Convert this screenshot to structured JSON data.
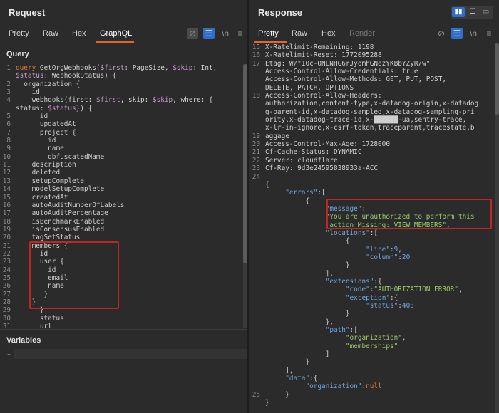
{
  "request": {
    "title": "Request",
    "tabs": [
      "Pretty",
      "Raw",
      "Hex",
      "GraphQL"
    ],
    "active_tab": "GraphQL",
    "query_label": "Query",
    "variables_label": "Variables",
    "variables_gutter": "1",
    "gutter": [
      "1",
      "2",
      "3",
      "4",
      "5",
      "6",
      "7",
      "8",
      "9",
      "10",
      "11",
      "12",
      "13",
      "14",
      "15",
      "16",
      "17",
      "18",
      "19",
      "20",
      "21",
      "22",
      "23",
      "24",
      "25",
      "26",
      "27",
      "28",
      "29",
      "30",
      "31"
    ],
    "lines": [
      [
        [
          "kw",
          "query "
        ],
        [
          "plain",
          "GetOrgWebhooks("
        ],
        [
          "var",
          "$first"
        ],
        [
          "plain",
          ": PageSize, "
        ],
        [
          "var",
          "$skip"
        ],
        [
          "plain",
          ": Int,"
        ]
      ],
      [
        [
          "var",
          "$status"
        ],
        [
          "plain",
          ": WebhookStatus) {"
        ]
      ],
      [
        [
          "plain",
          "  organization {"
        ]
      ],
      [
        [
          "plain",
          "    id"
        ]
      ],
      [
        [
          "plain",
          "    webhooks(first: "
        ],
        [
          "var",
          "$first"
        ],
        [
          "plain",
          ", skip: "
        ],
        [
          "var",
          "$skip"
        ],
        [
          "plain",
          ", where: {"
        ]
      ],
      [
        [
          "plain",
          "status: "
        ],
        [
          "var",
          "$status"
        ],
        [
          "plain",
          "}) {"
        ]
      ],
      [
        [
          "plain",
          "      id"
        ]
      ],
      [
        [
          "plain",
          "      updatedAt"
        ]
      ],
      [
        [
          "plain",
          "      project {"
        ]
      ],
      [
        [
          "plain",
          "        id"
        ]
      ],
      [
        [
          "plain",
          "        name"
        ]
      ],
      [
        [
          "plain",
          "        obfuscatedName"
        ]
      ],
      [
        [
          "plain",
          "    description"
        ]
      ],
      [
        [
          "plain",
          "    deleted"
        ]
      ],
      [
        [
          "plain",
          "    setupComplete"
        ]
      ],
      [
        [
          "plain",
          "    modelSetupComplete"
        ]
      ],
      [
        [
          "plain",
          "    createdAt"
        ]
      ],
      [
        [
          "plain",
          "    autoAuditNumberOfLabels"
        ]
      ],
      [
        [
          "plain",
          "    autoAuditPercentage"
        ]
      ],
      [
        [
          "plain",
          "    isBenchmarkEnabled"
        ]
      ],
      [
        [
          "plain",
          "    isConsensusEnabled"
        ]
      ],
      [
        [
          "plain",
          "    tagSetStatus"
        ]
      ],
      [
        [
          "plain",
          "    members {"
        ]
      ],
      [
        [
          "plain",
          "      id"
        ]
      ],
      [
        [
          "plain",
          "      user {"
        ]
      ],
      [
        [
          "plain",
          "        id"
        ]
      ],
      [
        [
          "plain",
          "        email"
        ]
      ],
      [
        [
          "plain",
          "        name"
        ]
      ],
      [
        [
          "plain",
          "       }"
        ]
      ],
      [
        [
          "plain",
          "    }"
        ]
      ],
      [
        [
          "plain",
          "      }"
        ]
      ],
      [
        [
          "plain",
          "      status"
        ]
      ],
      [
        [
          "plain",
          "      url"
        ]
      ]
    ]
  },
  "response": {
    "title": "Response",
    "tabs": [
      "Pretty",
      "Raw",
      "Hex",
      "Render"
    ],
    "active_tab": "Pretty",
    "gutter": [
      "15",
      "16",
      "17",
      "",
      "",
      "",
      "18",
      "",
      "",
      "",
      "",
      "19",
      "20",
      "21",
      "22",
      "23",
      "24",
      "",
      "",
      "",
      "",
      "",
      "",
      "",
      "",
      "",
      "",
      "",
      "",
      "",
      "",
      "",
      "",
      "",
      "",
      "",
      "",
      "",
      "",
      "",
      "",
      "",
      "",
      "",
      "25"
    ],
    "gutter_lines": [
      {
        "n": "15",
        "row": 0
      },
      {
        "n": "16",
        "row": 1
      },
      {
        "n": "17",
        "row": 2
      },
      {
        "n": "",
        "row": 3
      },
      {
        "n": "",
        "row": 4
      },
      {
        "n": "",
        "row": 5
      },
      {
        "n": "18",
        "row": 6
      },
      {
        "n": "19",
        "row": 11
      },
      {
        "n": "20",
        "row": 12
      },
      {
        "n": "21",
        "row": 13
      },
      {
        "n": "22",
        "row": 14
      },
      {
        "n": "23",
        "row": 15
      },
      {
        "n": "24",
        "row": 16
      },
      {
        "n": "25",
        "row": 43
      }
    ],
    "lines": [
      [
        [
          "plain",
          "X-Ratelimit-Remaining: 1198"
        ]
      ],
      [
        [
          "plain",
          "X-Ratelimit-Reset: 1772095288"
        ]
      ],
      [
        [
          "plain",
          "Etag: W/\"10c-ONLNHG6rJyomhGNezYKBbYZyR/w\""
        ]
      ],
      [
        [
          "plain",
          "Access-Control-Allow-Credentials: true"
        ]
      ],
      [
        [
          "plain",
          "Access-Control-Allow-Methods: GET, PUT, POST,"
        ]
      ],
      [
        [
          "plain",
          "DELETE, PATCH, OPTIONS"
        ]
      ],
      [
        [
          "plain",
          "Access-Control-Allow-Headers:"
        ]
      ],
      [
        [
          "plain",
          "authorization,content-type,x-datadog-origin,x-datadog"
        ]
      ],
      [
        [
          "plain",
          "g-parent-id,x-datadog-sampled,x-datadog-sampling-pri"
        ]
      ],
      [
        [
          "plain",
          "ority,x-datadog-trace-id,x-██████-ua,sentry-trace,"
        ]
      ],
      [
        [
          "plain",
          "x-lr-in-ignore,x-csrf-token,traceparent,tracestate,b"
        ]
      ],
      [
        [
          "plain",
          "aggage"
        ]
      ],
      [
        [
          "plain",
          "Access-Control-Max-Age: 1728000"
        ]
      ],
      [
        [
          "plain",
          "Cf-Cache-Status: DYNAMIC"
        ]
      ],
      [
        [
          "plain",
          "Server: cloudflare"
        ]
      ],
      [
        [
          "plain",
          "Cf-Ray: 9d3e24595838933a-ACC"
        ]
      ],
      [
        [
          "plain",
          ""
        ]
      ],
      [
        [
          "plain",
          "{"
        ]
      ],
      [
        [
          "plain",
          "     "
        ],
        [
          "key",
          "\"errors\""
        ],
        [
          "plain",
          ":["
        ]
      ],
      [
        [
          "plain",
          "          {"
        ]
      ],
      [
        [
          "plain",
          "               "
        ],
        [
          "key",
          "\"message\""
        ],
        [
          "plain",
          ":"
        ]
      ],
      [
        [
          "plain",
          "               "
        ],
        [
          "str",
          "\"You are unauthorized to perform this"
        ]
      ],
      [
        [
          "plain",
          "                "
        ],
        [
          "str",
          "action Missing: VIEW_MEMBERS\""
        ],
        [
          "plain",
          ","
        ]
      ],
      [
        [
          "plain",
          "               "
        ],
        [
          "key",
          "\"locations\""
        ],
        [
          "plain",
          ":["
        ]
      ],
      [
        [
          "plain",
          "                    {"
        ]
      ],
      [
        [
          "plain",
          "                         "
        ],
        [
          "key",
          "\"line\""
        ],
        [
          "plain",
          ":"
        ],
        [
          "num",
          "9"
        ],
        [
          "plain",
          ","
        ]
      ],
      [
        [
          "plain",
          "                         "
        ],
        [
          "key",
          "\"column\""
        ],
        [
          "plain",
          ":"
        ],
        [
          "num",
          "20"
        ]
      ],
      [
        [
          "plain",
          "                    }"
        ]
      ],
      [
        [
          "plain",
          "               ],"
        ]
      ],
      [
        [
          "plain",
          "               "
        ],
        [
          "key",
          "\"extensions\""
        ],
        [
          "plain",
          ":{"
        ]
      ],
      [
        [
          "plain",
          "                    "
        ],
        [
          "key",
          "\"code\""
        ],
        [
          "plain",
          ":"
        ],
        [
          "str",
          "\"AUTHORIZATION_ERROR\""
        ],
        [
          "plain",
          ","
        ]
      ],
      [
        [
          "plain",
          "                    "
        ],
        [
          "key",
          "\"exception\""
        ],
        [
          "plain",
          ":{"
        ]
      ],
      [
        [
          "plain",
          "                         "
        ],
        [
          "key",
          "\"status\""
        ],
        [
          "plain",
          ":"
        ],
        [
          "num",
          "403"
        ]
      ],
      [
        [
          "plain",
          "                    }"
        ]
      ],
      [
        [
          "plain",
          "               },"
        ]
      ],
      [
        [
          "plain",
          "               "
        ],
        [
          "key",
          "\"path\""
        ],
        [
          "plain",
          ":["
        ]
      ],
      [
        [
          "plain",
          "                    "
        ],
        [
          "str",
          "\"organization\""
        ],
        [
          "plain",
          ","
        ]
      ],
      [
        [
          "plain",
          "                    "
        ],
        [
          "str",
          "\"memberships\""
        ]
      ],
      [
        [
          "plain",
          "               ]"
        ]
      ],
      [
        [
          "plain",
          "          }"
        ]
      ],
      [
        [
          "plain",
          "     ],"
        ]
      ],
      [
        [
          "plain",
          "     "
        ],
        [
          "key",
          "\"data\""
        ],
        [
          "plain",
          ":{"
        ]
      ],
      [
        [
          "plain",
          "          "
        ],
        [
          "key",
          "\"organization\""
        ],
        [
          "plain",
          ":"
        ],
        [
          "kw",
          "null"
        ]
      ],
      [
        [
          "plain",
          "     }"
        ]
      ],
      [
        [
          "plain",
          "}"
        ]
      ]
    ]
  },
  "colors": {
    "accent": "#e0662c",
    "highlight_box": "#c02626",
    "toggle_active": "#2f6fc9"
  },
  "icons": [
    "eye-slash-icon",
    "wrap-lines-icon",
    "newline-icon",
    "menu-icon",
    "layout-split-icon",
    "layout-horizontal-icon",
    "layout-single-icon"
  ],
  "icon_glyphs": {
    "newline": "\\n",
    "menu": "≡",
    "wrap": "☰",
    "eyeslash": "⊘"
  }
}
